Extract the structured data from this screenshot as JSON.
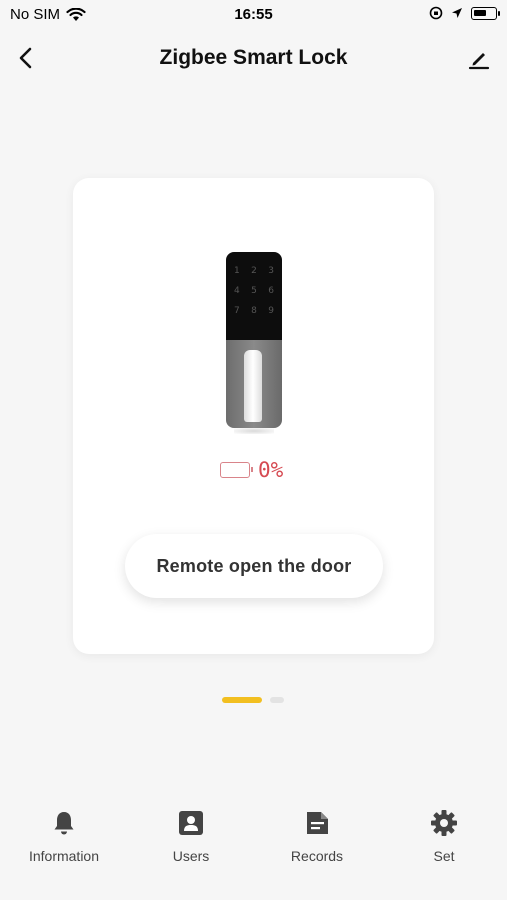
{
  "status_bar": {
    "carrier": "No SIM",
    "time": "16:55"
  },
  "header": {
    "title": "Zigbee Smart Lock",
    "back_icon": "chevron-left-icon",
    "edit_icon": "pencil-icon"
  },
  "device": {
    "keypad": [
      [
        "1",
        "2",
        "3"
      ],
      [
        "4",
        "5",
        "6"
      ],
      [
        "7",
        "8",
        "9"
      ]
    ],
    "battery_percent": "0%",
    "remote_button_label": "Remote open the door"
  },
  "page_indicator": {
    "active_color": "#f2bf20"
  },
  "tabs": [
    {
      "label": "Information",
      "icon": "bell-icon"
    },
    {
      "label": "Users",
      "icon": "user-icon"
    },
    {
      "label": "Records",
      "icon": "document-icon"
    },
    {
      "label": "Set",
      "icon": "gear-icon"
    }
  ]
}
